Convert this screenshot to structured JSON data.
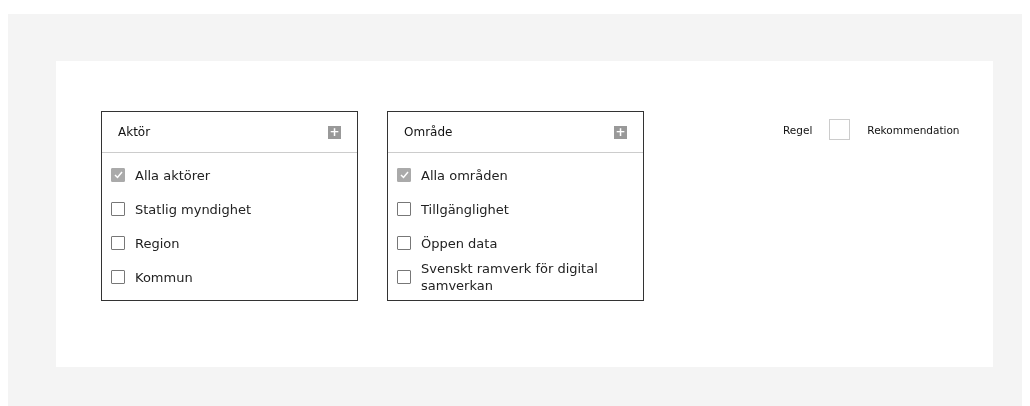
{
  "filters": [
    {
      "title": "Aktör",
      "add_button": "+",
      "options": [
        {
          "label": "Alla aktörer",
          "checked": true
        },
        {
          "label": "Statlig myndighet",
          "checked": false
        },
        {
          "label": "Region",
          "checked": false
        },
        {
          "label": "Kommun",
          "checked": false
        }
      ]
    },
    {
      "title": "Område",
      "add_button": "+",
      "options": [
        {
          "label": "Alla områden",
          "checked": true
        },
        {
          "label": "Tillgänglighet",
          "checked": false
        },
        {
          "label": "Öppen data",
          "checked": false
        },
        {
          "label": "Svenskt ramverk för digital samverkan",
          "checked": false
        }
      ]
    }
  ],
  "type_toggle": {
    "left_label": "Regel",
    "right_label": "Rekommendation",
    "on": false
  }
}
